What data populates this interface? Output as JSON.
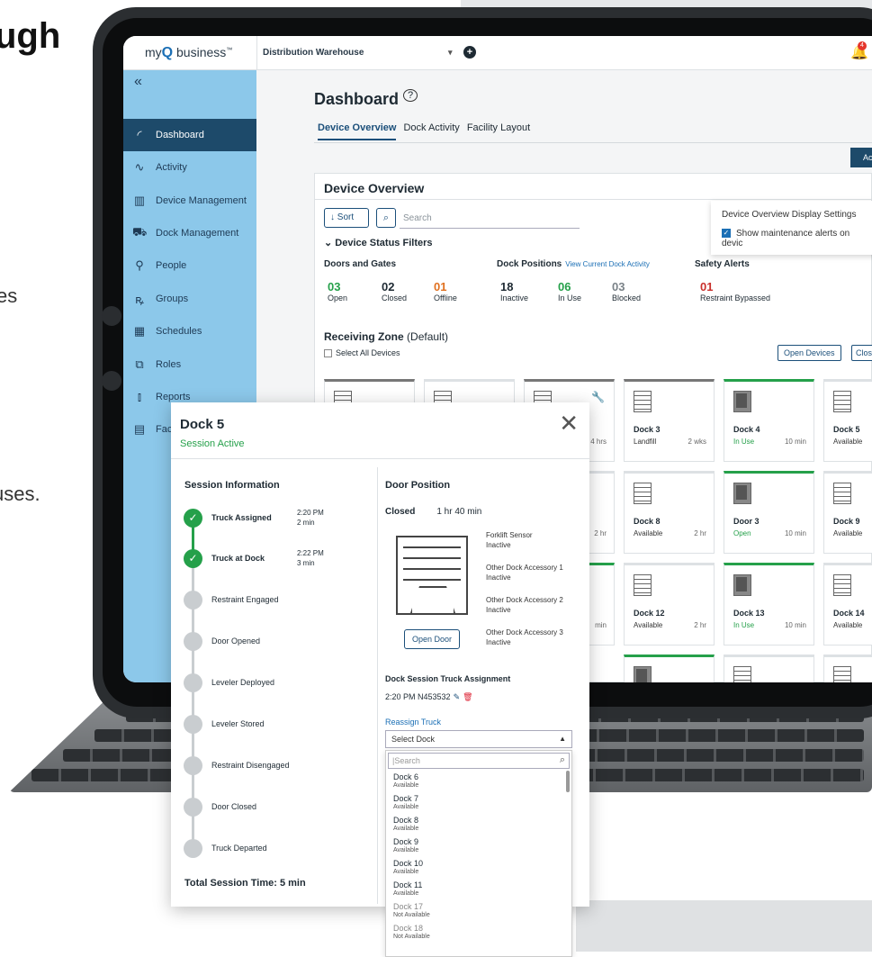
{
  "background": {
    "heading_fragment": "ugh",
    "text_es": "es",
    "text_uses": "uses."
  },
  "app": {
    "logo": {
      "my": "my",
      "q": "Q",
      "business": "business",
      "tm": "™"
    },
    "site": "Distribution Warehouse",
    "notification_count": "4"
  },
  "sidebar": {
    "items": [
      {
        "label": "Dashboard",
        "icon": "gauge-icon",
        "active": true
      },
      {
        "label": "Activity",
        "icon": "pulse-icon"
      },
      {
        "label": "Device Management",
        "icon": "building-icon"
      },
      {
        "label": "Dock Management",
        "icon": "truck-icon"
      },
      {
        "label": "People",
        "icon": "person-icon"
      },
      {
        "label": "Groups",
        "icon": "group-icon"
      },
      {
        "label": "Schedules",
        "icon": "calendar-icon"
      },
      {
        "label": "Roles",
        "icon": "roles-icon"
      },
      {
        "label": "Reports",
        "icon": "chart-icon"
      },
      {
        "label": "Fac",
        "icon": "facility-icon"
      }
    ]
  },
  "dashboard": {
    "title": "Dashboard",
    "help": "?",
    "tabs": [
      "Device Overview",
      "Dock Activity",
      "Facility Layout"
    ],
    "action_label": "Ac",
    "card_title": "Device Overview",
    "sort_label": "↓ Sort",
    "search_placeholder": "Search",
    "settings": {
      "title": "Device Overview Display Settings",
      "checkbox_label": "Show maintenance alerts on devic"
    },
    "filters_heading": "Device Status Filters",
    "groups": {
      "doors": "Doors and Gates",
      "dock": "Dock Positions",
      "dock_link": "View Current Dock Activity",
      "safety": "Safety Alerts"
    },
    "stats": [
      {
        "value": "03",
        "label": "Open",
        "color": "#25a04a"
      },
      {
        "value": "02",
        "label": "Closed",
        "color": "#1e2a33"
      },
      {
        "value": "01",
        "label": "Offline",
        "color": "#e0701f"
      },
      {
        "value": "18",
        "label": "Inactive",
        "color": "#1e2a33"
      },
      {
        "value": "06",
        "label": "In Use",
        "color": "#25a04a"
      },
      {
        "value": "03",
        "label": "Blocked",
        "color": "#7a8288"
      },
      {
        "value": "01",
        "label": "Restraint Bypassed",
        "color": "#c9302c"
      }
    ],
    "zone_name": "Receiving Zone",
    "zone_suffix": "(Default)",
    "select_all": "Select All Devices",
    "open_devices": "Open Devices",
    "close_devices": "Clos",
    "tiles": [
      {
        "name": "",
        "status": "",
        "time": ""
      },
      {
        "name": "",
        "status": "",
        "time": ""
      },
      {
        "name": "",
        "status": "",
        "time": "4 hrs"
      },
      {
        "name": "Dock 3",
        "status": "Landfill",
        "time": "2 wks"
      },
      {
        "name": "Dock 4",
        "status": "In Use",
        "time": "10 min"
      },
      {
        "name": "Dock 5",
        "status": "Available",
        "time": ""
      },
      {
        "name": "",
        "status": "",
        "time": "2 hr"
      },
      {
        "name": "Dock 8",
        "status": "Available",
        "time": "2 hr"
      },
      {
        "name": "Door 3",
        "status": "Open",
        "time": "10 min"
      },
      {
        "name": "Dock 9",
        "status": "Available",
        "time": ""
      },
      {
        "name": "",
        "status": "",
        "time": "min"
      },
      {
        "name": "Dock 12",
        "status": "Available",
        "time": "2 hr"
      },
      {
        "name": "Dock 13",
        "status": "In Use",
        "time": "10 min"
      },
      {
        "name": "Dock 14",
        "status": "Available",
        "time": ""
      }
    ]
  },
  "modal": {
    "title": "Dock 5",
    "subtitle": "Session Active",
    "session_heading": "Session Information",
    "steps": [
      {
        "label": "Truck Assigned",
        "time": "2:20 PM",
        "duration": "2 min",
        "done": true
      },
      {
        "label": "Truck at Dock",
        "time": "2:22 PM",
        "duration": "3 min",
        "done": true
      },
      {
        "label": "Restraint Engaged",
        "done": false
      },
      {
        "label": "Door Opened",
        "done": false
      },
      {
        "label": "Leveler Deployed",
        "done": false
      },
      {
        "label": "Leveler Stored",
        "done": false
      },
      {
        "label": "Restraint Disengaged",
        "done": false
      },
      {
        "label": "Door Closed",
        "done": false
      },
      {
        "label": "Truck Departed",
        "done": false
      }
    ],
    "total_label": "Total Session Time:",
    "total_value": "5 min",
    "door_heading": "Door Position",
    "door_state": "Closed",
    "door_duration": "1 hr 40 min",
    "accessories": [
      {
        "name": "Forklift Sensor",
        "status": "Inactive"
      },
      {
        "name": "Other Dock Accessory 1",
        "status": "Inactive"
      },
      {
        "name": "Other Dock Accessory 2",
        "status": "Inactive"
      },
      {
        "name": "Other Dock Accessory 3",
        "status": "Inactive"
      }
    ],
    "open_door": "Open Door",
    "assignment_heading": "Dock Session Truck Assignment",
    "assignment_value": "2:20 PM  N453532",
    "reassign": "Reassign Truck",
    "select_placeholder": "Select Dock",
    "dropdown_search": "|Search",
    "dropdown_items": [
      {
        "name": "Dock 6",
        "status": "Available"
      },
      {
        "name": "Dock 7",
        "status": "Available"
      },
      {
        "name": "Dock 8",
        "status": "Available"
      },
      {
        "name": "Dock 9",
        "status": "Available"
      },
      {
        "name": "Dock 10",
        "status": "Available"
      },
      {
        "name": "Dock 11",
        "status": "Available"
      },
      {
        "name": "Dock 17",
        "status": "Not Available"
      },
      {
        "name": "Dock 18",
        "status": "Not Available"
      }
    ]
  }
}
